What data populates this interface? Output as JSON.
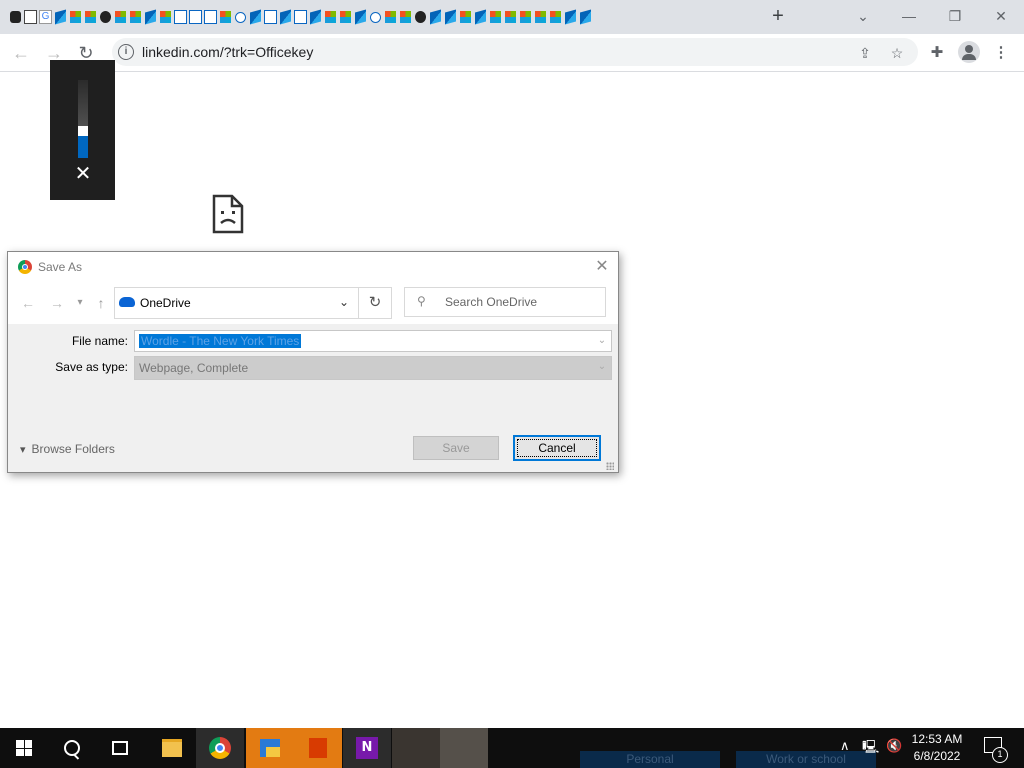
{
  "browser": {
    "new_tab_glyph": "+",
    "tab_favicons": [
      "dark",
      "rec",
      "g",
      "o365",
      "ms",
      "ms",
      "gh",
      "ms",
      "ms",
      "o365",
      "ms",
      "doc",
      "doc",
      "doc",
      "ms",
      "li",
      "o365",
      "doc",
      "o365",
      "doc",
      "o365",
      "ms",
      "ms",
      "o365",
      "li",
      "ms",
      "ms",
      "gh",
      "o365",
      "o365",
      "ms",
      "o365",
      "ms",
      "ms",
      "ms",
      "ms",
      "ms",
      "o365",
      "o365"
    ],
    "window_controls": {
      "minimize": "—",
      "restore": "❐",
      "close": "✕",
      "tab_search": "⌄"
    },
    "url": "linkedin.com/?trk=Officekey",
    "toolbar_icons": [
      "back-arrow-icon",
      "forward-arrow-icon",
      "reload-icon",
      "share-icon",
      "star-icon",
      "extensions-icon",
      "profile-icon",
      "menu-icon"
    ]
  },
  "volume_osd": {
    "level": 0.28,
    "close_glyph": "✕"
  },
  "dialog": {
    "title": "Save As",
    "location": "OneDrive",
    "search_placeholder": "Search OneDrive",
    "file_name_label": "File name:",
    "file_name_value": "Wordle - The New York Times",
    "save_type_label": "Save as type:",
    "save_type_value": "Webpage, Complete",
    "browse_folders": "Browse Folders",
    "save_button": "Save",
    "cancel_button": "Cancel"
  },
  "taskbar": {
    "apps": [
      "start",
      "search",
      "task-view",
      "file-explorer",
      "chrome",
      "onedrive",
      "office",
      "onenote"
    ],
    "clock_time": "12:53 AM",
    "clock_date": "6/8/2022",
    "notification_count": "1",
    "background_text": [
      "Personal",
      "Work or school"
    ]
  },
  "colors": {
    "accent": "#0078d7",
    "chrome_bar": "#dee1e6",
    "taskbar": "#0e0e0e",
    "onenote": "#7719aa"
  }
}
